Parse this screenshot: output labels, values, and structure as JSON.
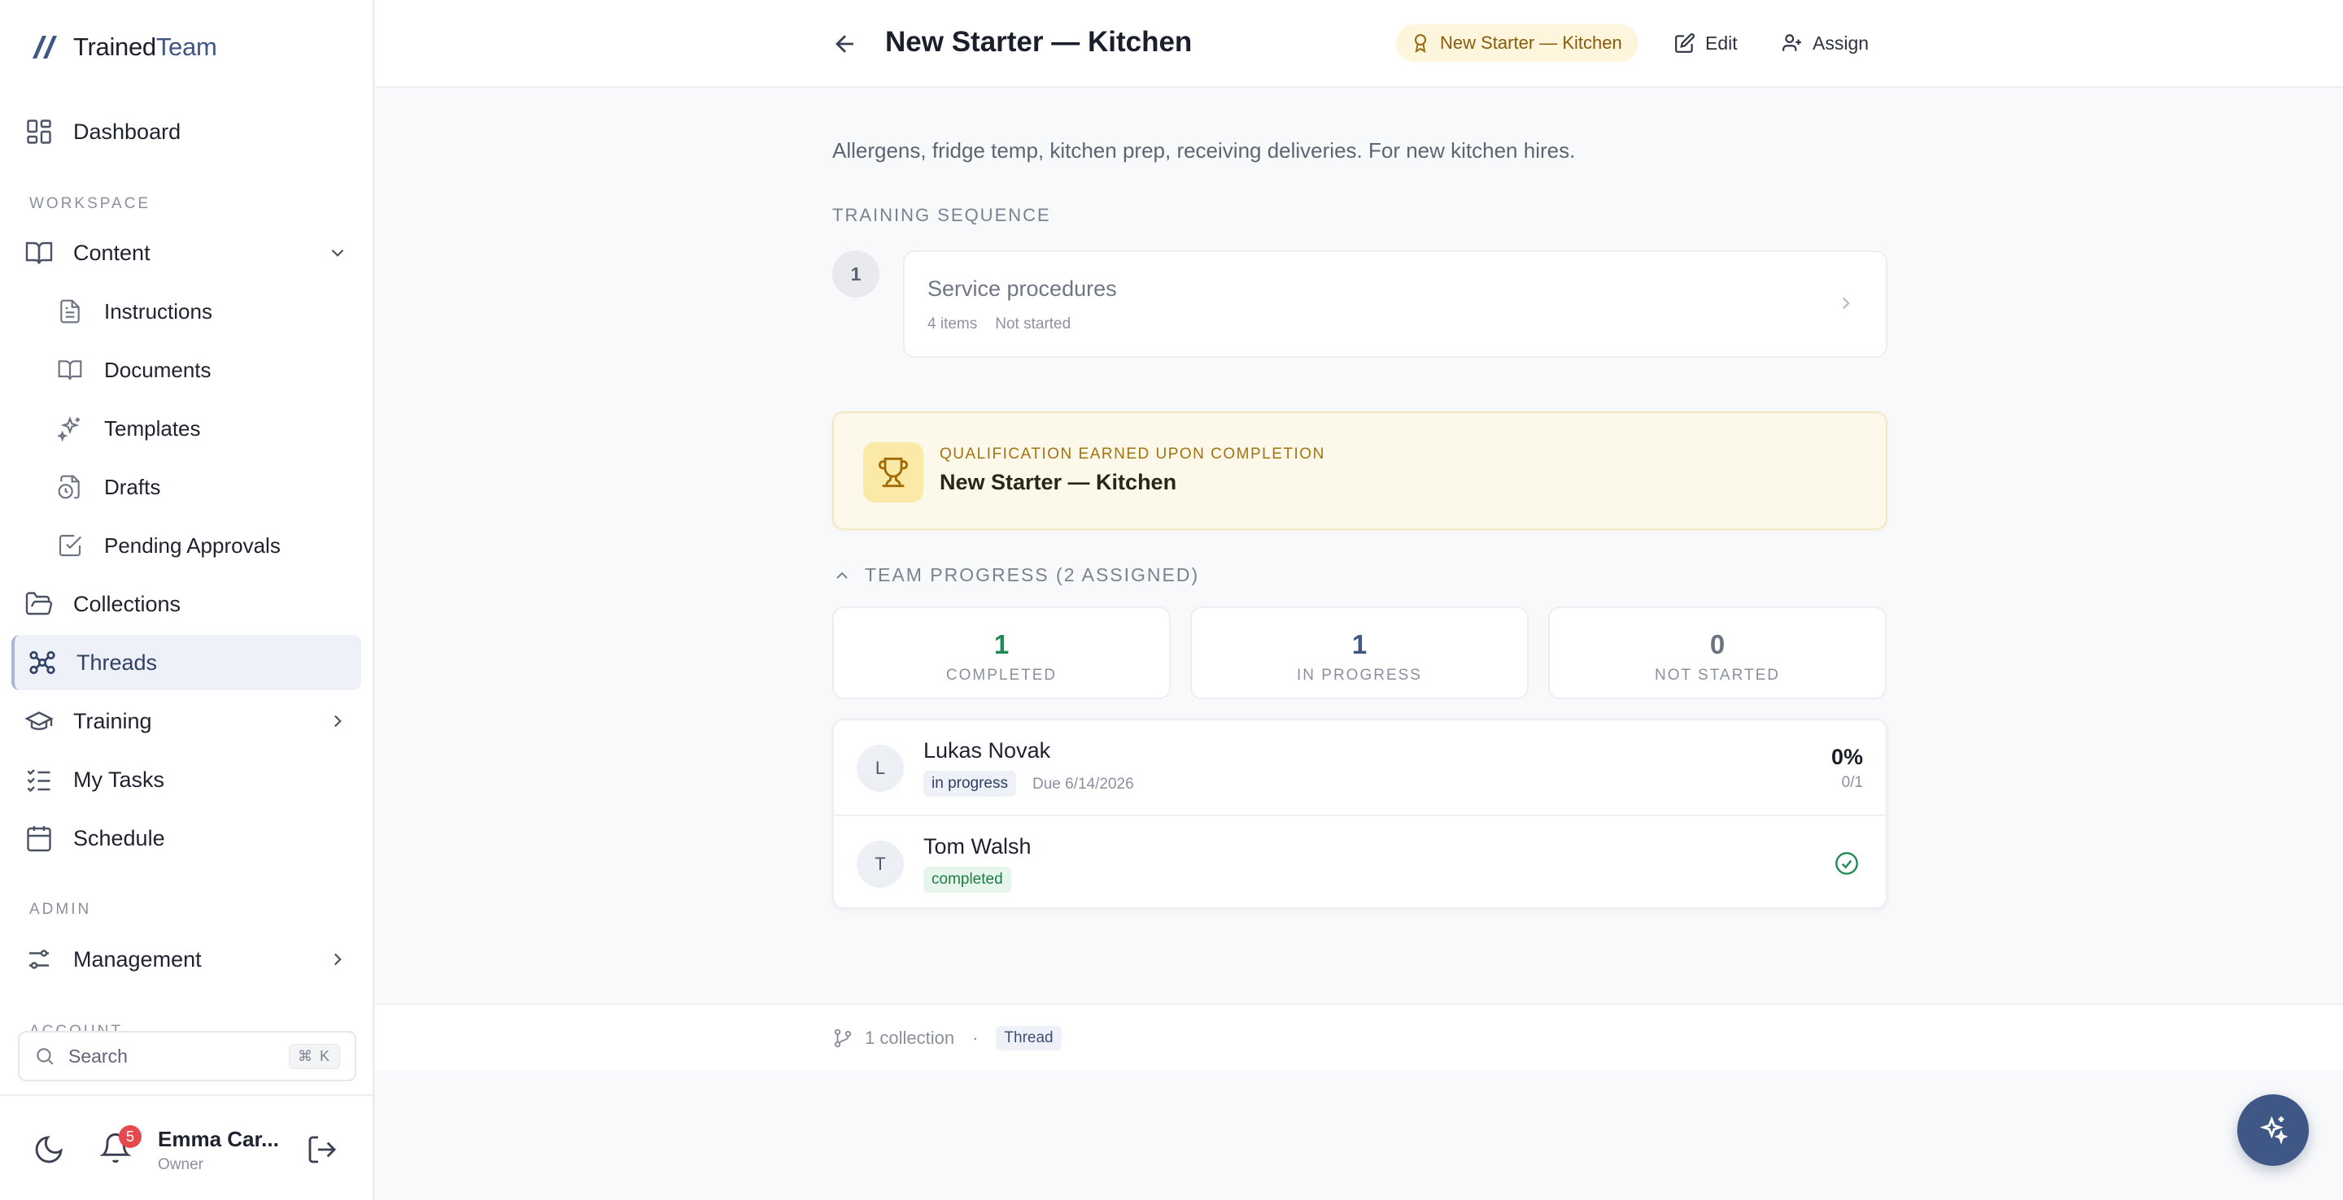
{
  "app": {
    "logo_primary": "Trained",
    "logo_accent": "Team"
  },
  "sidebar": {
    "dashboard": "Dashboard",
    "workspace_label": "WORKSPACE",
    "content": "Content",
    "sub_items": [
      "Instructions",
      "Documents",
      "Templates",
      "Drafts",
      "Pending Approvals"
    ],
    "collections": "Collections",
    "threads": "Threads",
    "training": "Training",
    "my_tasks": "My Tasks",
    "schedule": "Schedule",
    "admin_label": "ADMIN",
    "management": "Management",
    "account_label_partial": "ACCOUNT",
    "search_placeholder": "Search",
    "search_shortcut": "⌘ K"
  },
  "user": {
    "name": "Emma Car...",
    "role": "Owner",
    "notifications": "5"
  },
  "header": {
    "title": "New Starter — Kitchen",
    "qualification_pill": "New Starter — Kitchen",
    "edit": "Edit",
    "assign": "Assign"
  },
  "main": {
    "description": "Allergens, fridge temp, kitchen prep, receiving deliveries. For new kitchen hires.",
    "sequence_label": "TRAINING SEQUENCE",
    "steps": [
      {
        "number": "1",
        "title": "Service procedures",
        "items": "4 items",
        "status": "Not started"
      }
    ],
    "qualification": {
      "kicker": "QUALIFICATION EARNED UPON COMPLETION",
      "name": "New Starter — Kitchen"
    },
    "team_progress": {
      "heading": "TEAM PROGRESS (2 ASSIGNED)",
      "stats": [
        {
          "value": "1",
          "label": "COMPLETED",
          "color": "#1f8a56"
        },
        {
          "value": "1",
          "label": "IN PROGRESS",
          "color": "#3e5784"
        },
        {
          "value": "0",
          "label": "NOT STARTED",
          "color": "#6b7280"
        }
      ],
      "members": [
        {
          "initial": "L",
          "name": "Lukas Novak",
          "status": "in progress",
          "due": "Due 6/14/2026",
          "percent": "0%",
          "fraction": "0/1"
        },
        {
          "initial": "T",
          "name": "Tom Walsh",
          "status": "completed",
          "due": "",
          "percent": "",
          "fraction": ""
        }
      ]
    },
    "footer_meta": {
      "collections": "1 collection",
      "separator": "·",
      "type_chip": "Thread"
    }
  },
  "colors": {
    "accent": "#3e5784",
    "success": "#1f8a56",
    "qualification_bg": "#fdf9ea"
  }
}
